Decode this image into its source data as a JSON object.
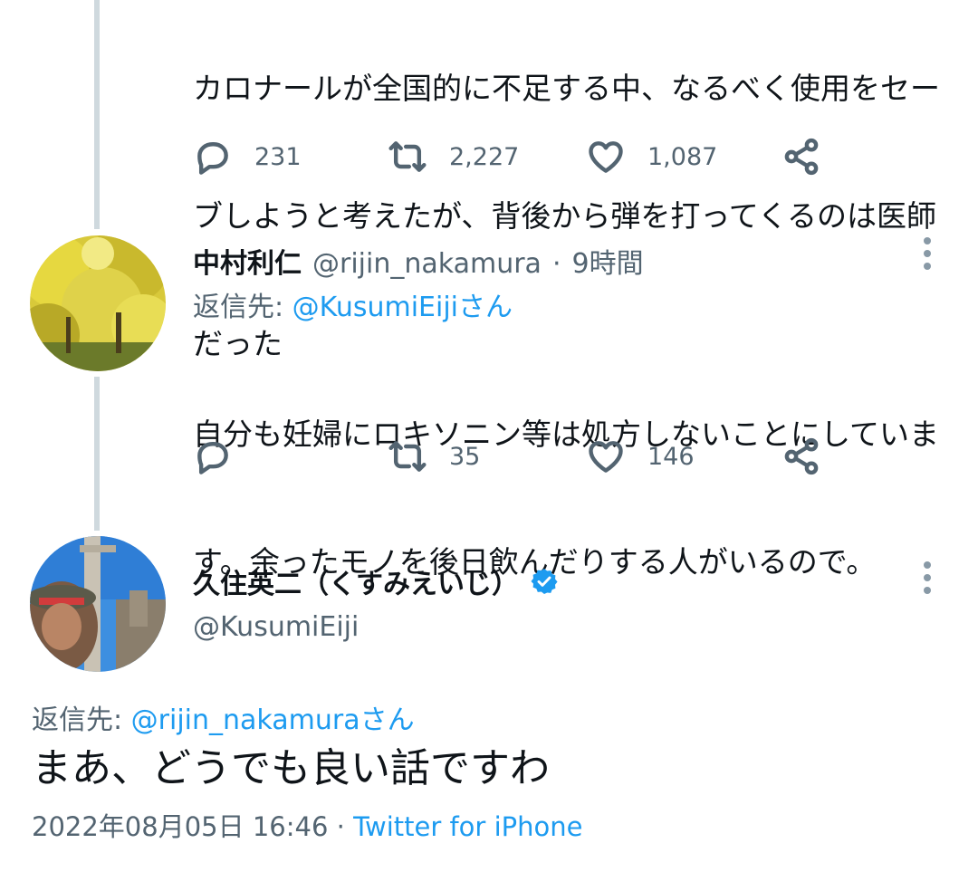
{
  "previous_tweet": {
    "text_lines": [
      "カロナールが全国的に不足する中、なるべく使用をセー",
      "ブしようと考えたが、背後から弾を打ってくるのは医師",
      "だった"
    ],
    "actions": {
      "replies": "231",
      "retweets": "2,227",
      "likes": "1,087"
    }
  },
  "reply_tweet": {
    "display_name": "中村利仁",
    "handle": "@rijin_nakamura",
    "separator": "·",
    "time": "9時間",
    "reply_to_prefix": "返信先:",
    "reply_to_handle": "@KusumiEiji",
    "reply_to_suffix": "さん",
    "text_lines": [
      "自分も妊婦にロキソニン等は処方しないことにしていま",
      "す。余ったモノを後日飲んだりする人がいるので。"
    ],
    "actions": {
      "replies": "",
      "retweets": "35",
      "likes": "146"
    }
  },
  "main_tweet": {
    "display_name": "久住英二（くすみえいじ）",
    "handle": "@KusumiEiji",
    "verified": true,
    "reply_to_prefix": "返信先:",
    "reply_to_handle": "@rijin_nakamura",
    "reply_to_suffix": "さん",
    "text": "まあ、どうでも良い話ですわ",
    "timestamp": "2022年08月05日 16:46",
    "meta_separator": "·",
    "source": "Twitter for iPhone"
  },
  "icons": {
    "reply": "reply-icon",
    "retweet": "retweet-icon",
    "like": "heart-icon",
    "share": "share-icon",
    "more": "more-vertical-icon",
    "verified": "verified-badge-icon"
  },
  "colors": {
    "accent": "#1d9bf0",
    "secondary_text": "#536471",
    "thread_line": "#cfd9de"
  }
}
